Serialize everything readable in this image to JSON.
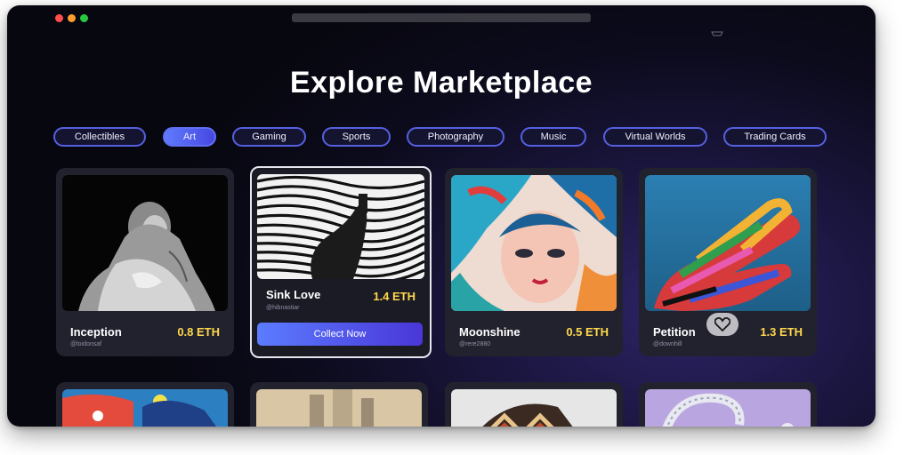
{
  "page": {
    "title": "Explore Marketplace"
  },
  "categories": [
    {
      "label": "Collectibles",
      "active": false
    },
    {
      "label": "Art",
      "active": true
    },
    {
      "label": "Gaming",
      "active": false
    },
    {
      "label": "Sports",
      "active": false
    },
    {
      "label": "Photography",
      "active": false
    },
    {
      "label": "Music",
      "active": false
    },
    {
      "label": "Virtual Worlds",
      "active": false
    },
    {
      "label": "Trading Cards",
      "active": false
    }
  ],
  "cards": [
    {
      "name": "Inception",
      "handle": "@loidonsaf",
      "price": "0.8 ETH"
    },
    {
      "name": "Sink Love",
      "handle": "@hibnastiar",
      "price": "1.4 ETH",
      "button": "Collect Now"
    },
    {
      "name": "Moonshine",
      "handle": "@rere2880",
      "price": "0.5 ETH"
    },
    {
      "name": "Petition",
      "handle": "@downhill",
      "price": "1.3 ETH"
    }
  ],
  "colors": {
    "accent": "#5560e0",
    "price": "#ffd84a",
    "background": "#0c0b1c"
  }
}
